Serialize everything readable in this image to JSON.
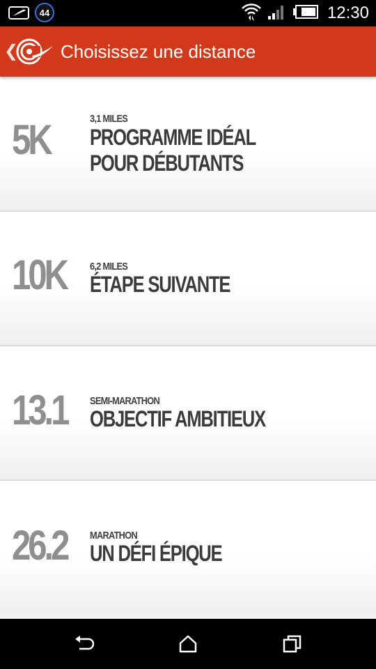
{
  "status_bar": {
    "notification_badge": "44",
    "time": "12:30",
    "icons": [
      "notification-icon",
      "wifi-icon",
      "signal-icon",
      "battery-icon"
    ]
  },
  "header": {
    "title": "Choisissez une distance",
    "background_color": "#d2391a"
  },
  "distances": [
    {
      "value": "5K",
      "subtitle": "3,1 MILES",
      "description": "PROGRAMME IDÉAL POUR DÉBUTANTS"
    },
    {
      "value": "10K",
      "subtitle": "6,2 MILES",
      "description": "ÉTAPE SUIVANTE"
    },
    {
      "value": "13.1",
      "subtitle": "SEMI-MARATHON",
      "description": "OBJECTIF AMBITIEUX"
    },
    {
      "value": "26.2",
      "subtitle": "MARATHON",
      "description": "UN DÉFI ÉPIQUE"
    }
  ],
  "nav_bar": {
    "icons": [
      "back-icon",
      "home-icon",
      "recent-apps-icon"
    ]
  }
}
